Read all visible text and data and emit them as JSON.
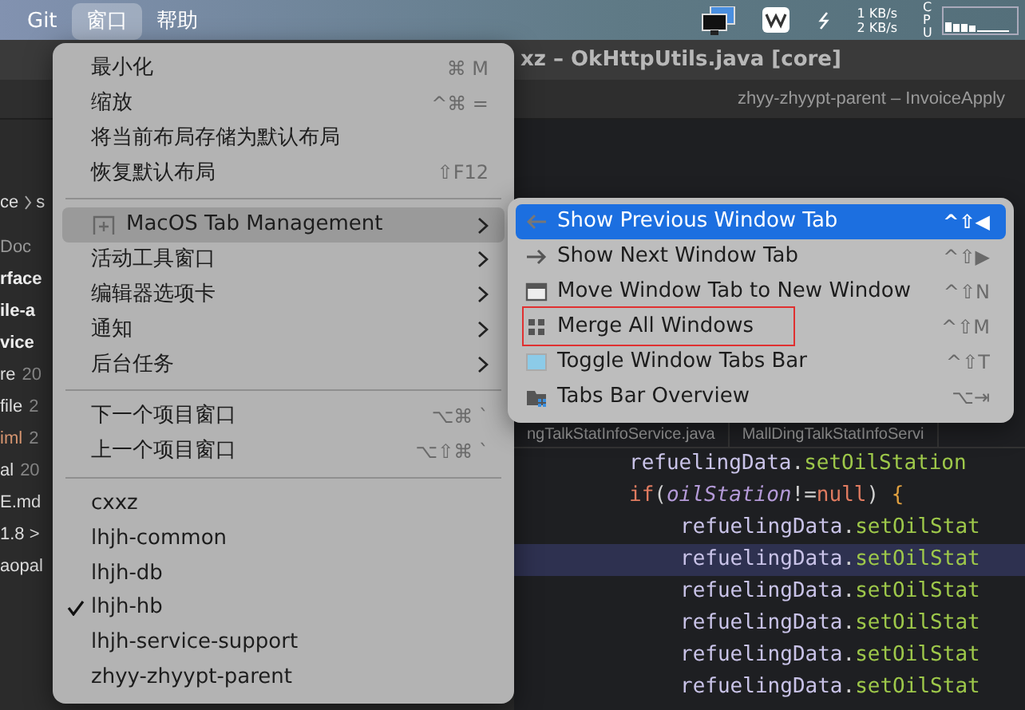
{
  "menubar": {
    "items": [
      {
        "label": "Git",
        "selected": false
      },
      {
        "label": "窗口",
        "selected": true
      },
      {
        "label": "帮助",
        "selected": false
      }
    ],
    "net_up": "1 KB/s",
    "net_down": "2 KB/s",
    "cpu_label": "CPU"
  },
  "ide": {
    "title": "xz – OkHttpUtils.java [core]",
    "project_tab": "zhyy-zhyypt-parent – InvoiceApply",
    "breadcrumb": [
      "ce",
      "s"
    ],
    "sidebar": [
      {
        "text": "Doc",
        "kind": "tab"
      },
      {
        "text": "rface",
        "kind": "module"
      },
      {
        "text": "ile-a",
        "kind": "module"
      },
      {
        "text": "vice",
        "kind": "module"
      },
      {
        "text": "re",
        "date": "20",
        "kind": "file"
      },
      {
        "text": "file",
        "date": "2",
        "kind": "file"
      },
      {
        "text": "iml",
        "date": "2",
        "kind": "config"
      },
      {
        "text": "al",
        "date": "20",
        "kind": "file"
      },
      {
        "text": "E.md",
        "kind": "file"
      },
      {
        "text": "1.8 >",
        "kind": "file"
      },
      {
        "text": "aopal",
        "kind": "file"
      }
    ],
    "editor_tabs": [
      {
        "label": "ngTalkStatInfoService.java",
        "selected": false
      },
      {
        "label": "MallDingTalkStatInfoServi",
        "selected": false
      }
    ],
    "code_lines": [
      {
        "highlighted": false,
        "tokens": [
          {
            "text": "refuelingData",
            "kind": "ident"
          },
          {
            "text": ".",
            "kind": "punct"
          },
          {
            "text": "setOilStation",
            "kind": "method"
          }
        ]
      },
      {
        "highlighted": false,
        "tokens": [
          {
            "text": "if",
            "kind": "keyword"
          },
          {
            "text": "(",
            "kind": "punct"
          },
          {
            "text": "oilStation",
            "kind": "var"
          },
          {
            "text": "!=",
            "kind": "punct"
          },
          {
            "text": "null",
            "kind": "keyword"
          },
          {
            "text": ") ",
            "kind": "punct"
          },
          {
            "text": "{",
            "kind": "brace"
          }
        ],
        "children": [
          {
            "highlighted": false,
            "tokens": [
              {
                "text": "refuelingData",
                "kind": "ident"
              },
              {
                "text": ".",
                "kind": "punct"
              },
              {
                "text": "setOilStat",
                "kind": "method"
              }
            ]
          },
          {
            "highlighted": true,
            "tokens": [
              {
                "text": "refuelingData",
                "kind": "ident"
              },
              {
                "text": ".",
                "kind": "punct"
              },
              {
                "text": "setOilStat",
                "kind": "method"
              }
            ]
          },
          {
            "highlighted": false,
            "tokens": [
              {
                "text": "refuelingData",
                "kind": "ident"
              },
              {
                "text": ".",
                "kind": "punct"
              },
              {
                "text": "setOilStat",
                "kind": "method"
              }
            ]
          },
          {
            "highlighted": false,
            "tokens": [
              {
                "text": "refuelingData",
                "kind": "ident"
              },
              {
                "text": ".",
                "kind": "punct"
              },
              {
                "text": "setOilStat",
                "kind": "method"
              }
            ]
          },
          {
            "highlighted": false,
            "tokens": [
              {
                "text": "refuelingData",
                "kind": "ident"
              },
              {
                "text": ".",
                "kind": "punct"
              },
              {
                "text": "setOilStat",
                "kind": "method"
              }
            ]
          },
          {
            "highlighted": false,
            "tokens": [
              {
                "text": "refuelingData",
                "kind": "ident"
              },
              {
                "text": ".",
                "kind": "punct"
              },
              {
                "text": "setOilStat",
                "kind": "method"
              }
            ]
          }
        ]
      }
    ]
  },
  "window_menu": {
    "items": [
      {
        "kind": "item",
        "label": "最小化",
        "shortcut": "⌘ M"
      },
      {
        "kind": "item",
        "label": "缩放",
        "shortcut": "^⌘ ="
      },
      {
        "kind": "item",
        "label": "将当前布局存储为默认布局"
      },
      {
        "kind": "item",
        "label": "恢复默认布局",
        "shortcut": "⇧F12"
      },
      {
        "kind": "separator"
      },
      {
        "kind": "submenu",
        "label": "MacOS Tab Management",
        "has_icon": true,
        "selected": true
      },
      {
        "kind": "submenu",
        "label": "活动工具窗口",
        "selected": false
      },
      {
        "kind": "submenu",
        "label": "编辑器选项卡",
        "selected": false
      },
      {
        "kind": "submenu",
        "label": "通知",
        "selected": false
      },
      {
        "kind": "submenu",
        "label": "后台任务",
        "selected": false
      },
      {
        "kind": "separator"
      },
      {
        "kind": "item",
        "label": "下一个项目窗口",
        "shortcut": "⌥⌘ `"
      },
      {
        "kind": "item",
        "label": "上一个项目窗口",
        "shortcut": "⌥⇧⌘ `"
      },
      {
        "kind": "separator"
      },
      {
        "kind": "project",
        "label": "cxxz",
        "checked": false
      },
      {
        "kind": "project",
        "label": "lhjh-common",
        "checked": false
      },
      {
        "kind": "project",
        "label": "lhjh-db",
        "checked": false
      },
      {
        "kind": "project",
        "label": "lhjh-hb",
        "checked": true
      },
      {
        "kind": "project",
        "label": "lhjh-service-support",
        "checked": false
      },
      {
        "kind": "project",
        "label": "zhyy-zhyypt-parent",
        "checked": false
      }
    ]
  },
  "tab_submenu": {
    "items": [
      {
        "label": "Show Previous Window Tab",
        "shortcut": "^⇧◀",
        "selected": true,
        "annotated": false
      },
      {
        "label": "Show Next Window Tab",
        "shortcut": "^⇧▶",
        "selected": false,
        "annotated": false
      },
      {
        "label": "Move Window Tab to New Window",
        "shortcut": "^⇧N",
        "selected": false,
        "annotated": false
      },
      {
        "label": "Merge All Windows",
        "shortcut": "^⇧M",
        "selected": false,
        "annotated": true
      },
      {
        "label": "Toggle Window Tabs Bar",
        "shortcut": "^⇧T",
        "selected": false,
        "annotated": false
      },
      {
        "label": "Tabs Bar Overview",
        "shortcut": "⌥⇥",
        "selected": false,
        "annotated": false
      }
    ]
  }
}
